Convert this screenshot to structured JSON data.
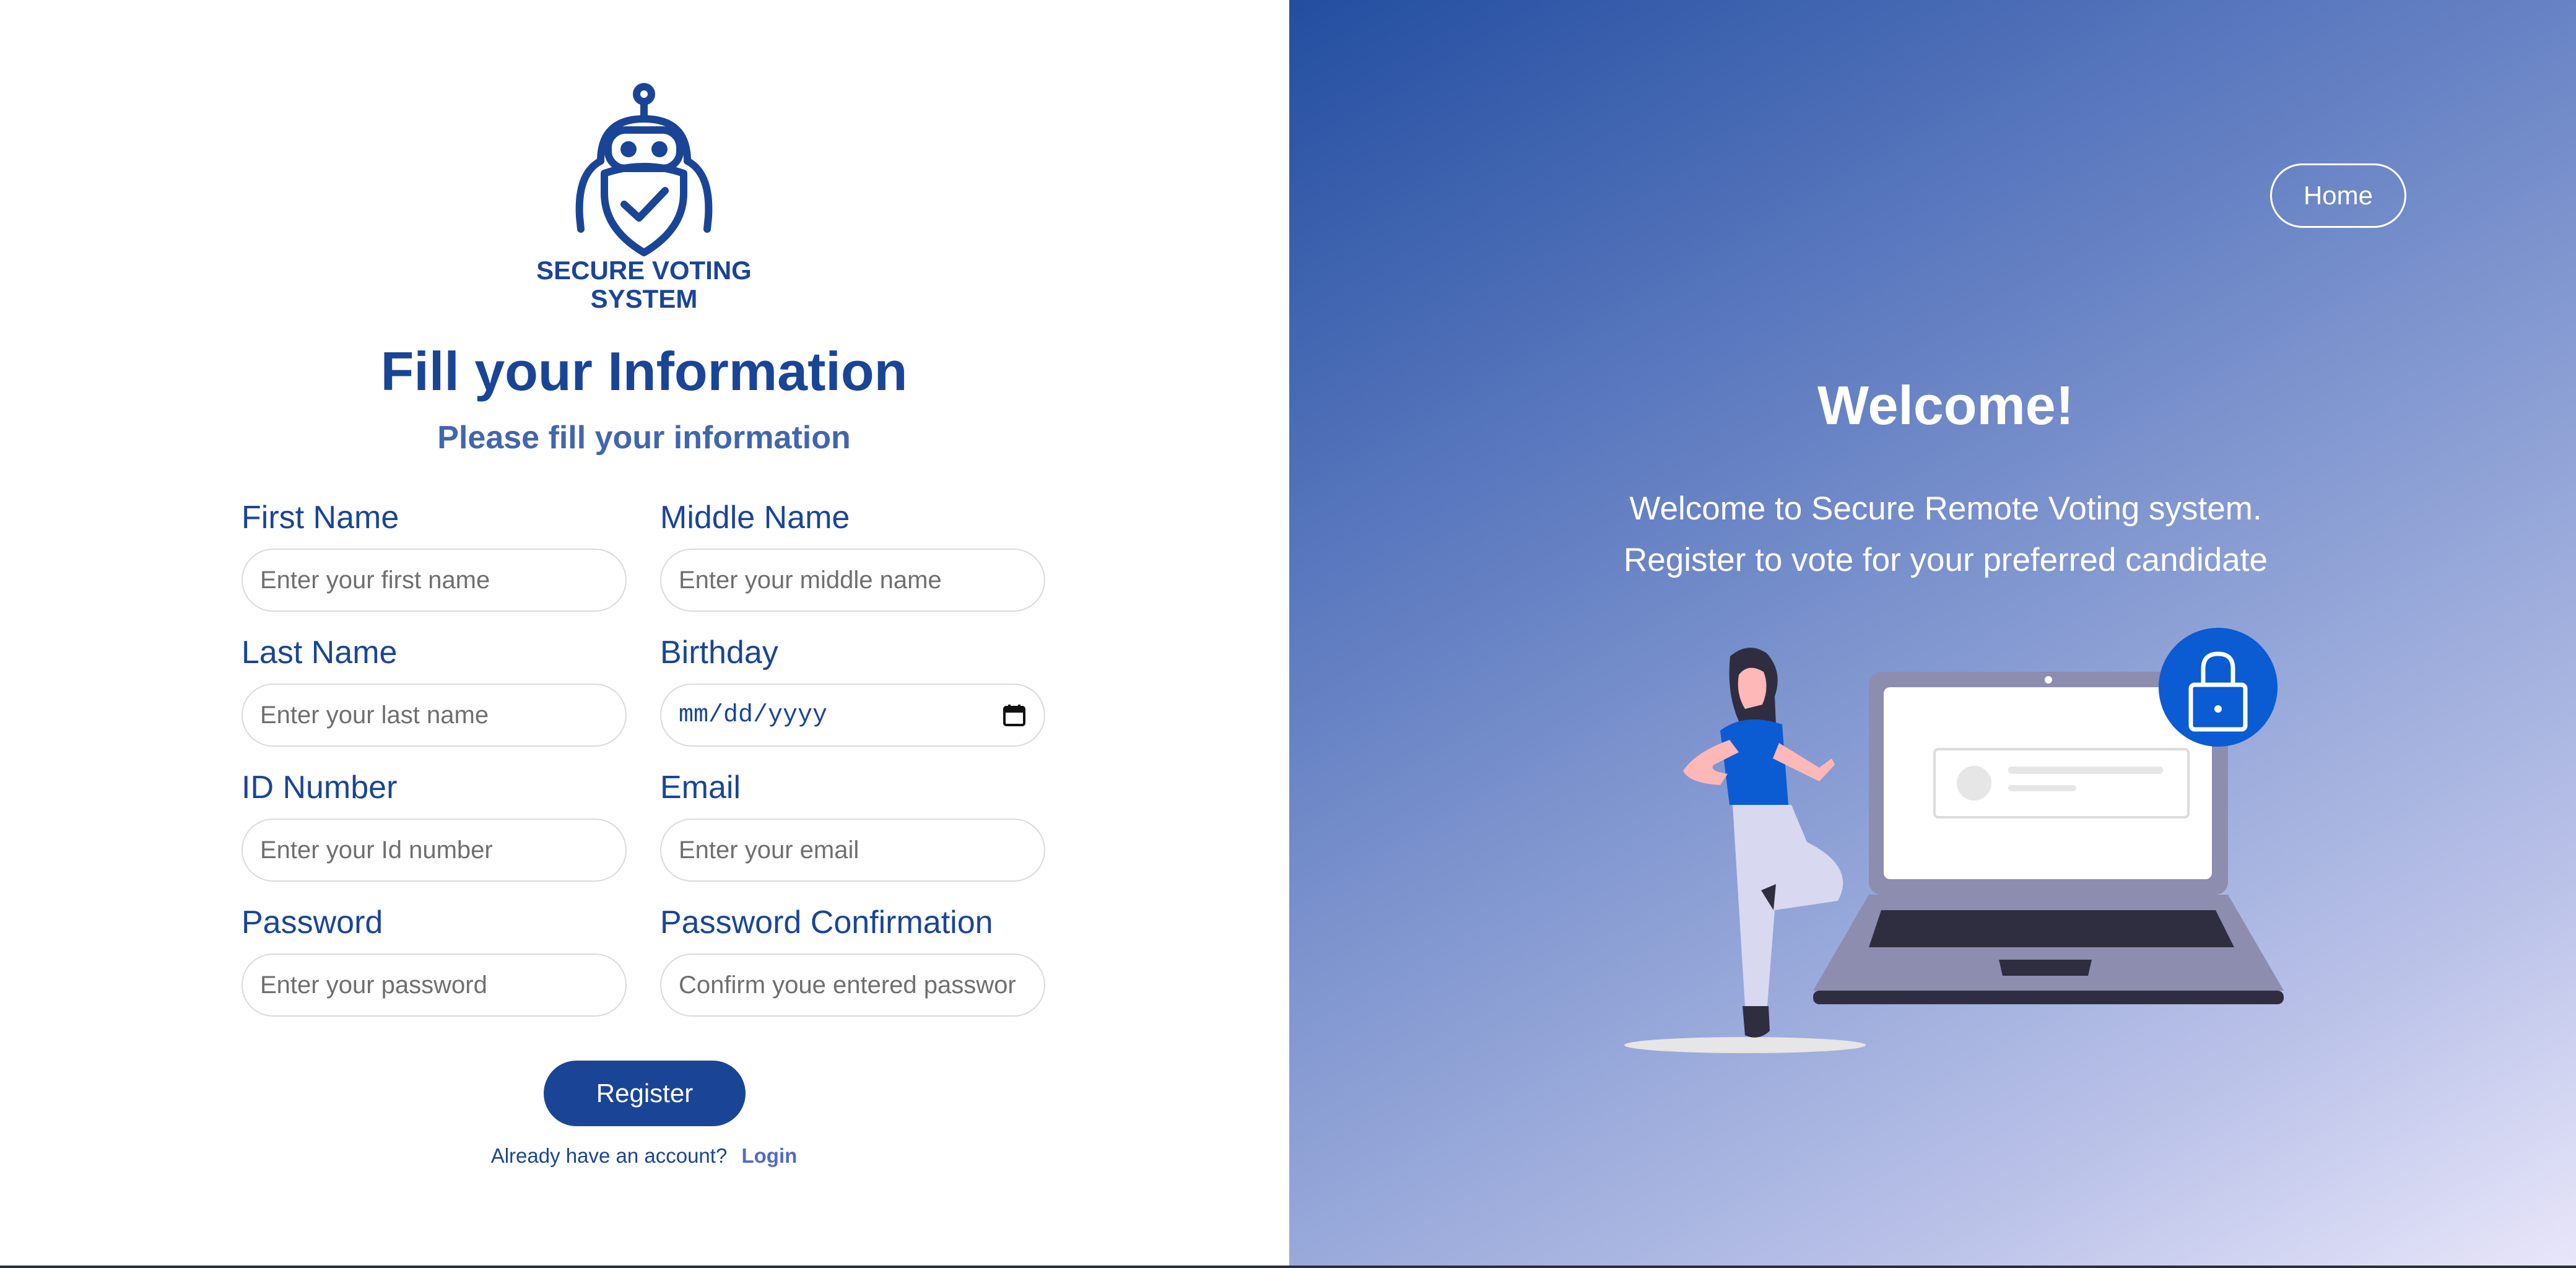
{
  "brand": {
    "line1": "SECURE VOTING",
    "line2": "SYSTEM"
  },
  "form": {
    "title": "Fill your Information",
    "subtitle": "Please fill your information",
    "fields": {
      "first_name": {
        "label": "First Name",
        "placeholder": "Enter your first name"
      },
      "middle_name": {
        "label": "Middle Name",
        "placeholder": "Enter your middle name"
      },
      "last_name": {
        "label": "Last Name",
        "placeholder": "Enter your last name"
      },
      "birthday": {
        "label": "Birthday",
        "placeholder": "mm/dd/yyyy"
      },
      "id_number": {
        "label": "ID Number",
        "placeholder": "Enter your Id number"
      },
      "email": {
        "label": "Email",
        "placeholder": "Enter your email"
      },
      "password": {
        "label": "Password",
        "placeholder": "Enter your password"
      },
      "password_confirmation": {
        "label": "Password Confirmation",
        "placeholder": "Confirm youe entered passwor"
      }
    },
    "register_label": "Register",
    "login_prompt": "Already have an account?",
    "login_link": "Login"
  },
  "welcome": {
    "home_label": "Home",
    "title": "Welcome!",
    "line1": "Welcome to Secure Remote Voting system.",
    "line2": "Register to vote for your preferred candidate"
  },
  "colors": {
    "primary": "#1a4597",
    "accent_link": "#5269c9",
    "panel_gradient_start": "#234ea0",
    "panel_gradient_end": "#e8e6fa",
    "lock_badge": "#0b5bd3"
  },
  "icons": [
    "robot-shield-logo-icon",
    "calendar-icon",
    "lock-icon"
  ]
}
